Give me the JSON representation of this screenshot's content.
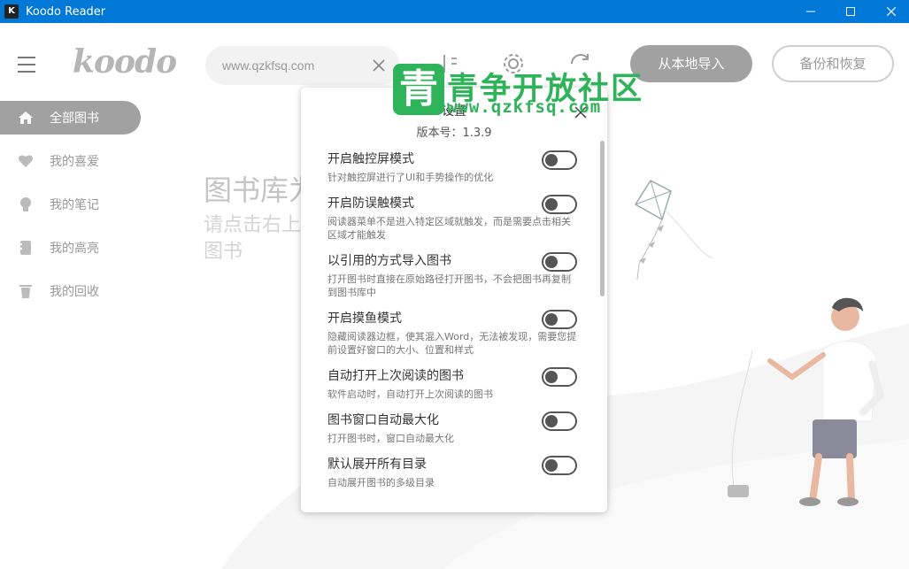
{
  "window": {
    "title": "Koodo Reader",
    "icon_letter": "K"
  },
  "header": {
    "logo": "koodo",
    "search_value": "www.qzkfsq.com",
    "import_button": "从本地导入",
    "backup_button": "备份和恢复"
  },
  "watermark": {
    "badge": "青",
    "title": "青争开放社区",
    "url": "www.qzkfsq.com"
  },
  "sidebar": {
    "items": [
      {
        "label": "全部图书",
        "icon": "home-icon",
        "active": true
      },
      {
        "label": "我的喜爱",
        "icon": "heart-icon",
        "active": false
      },
      {
        "label": "我的笔记",
        "icon": "lightbulb-icon",
        "active": false
      },
      {
        "label": "我的高亮",
        "icon": "notebook-icon",
        "active": false
      },
      {
        "label": "我的回收",
        "icon": "trash-icon",
        "active": false
      }
    ]
  },
  "empty_state": {
    "title": "图书库为空",
    "line1": "请点击右上角按钮添加",
    "line2": "图书"
  },
  "settings_dialog": {
    "title": "设置",
    "version": "版本号：1.3.9",
    "items": [
      {
        "label": "开启触控屏模式",
        "desc": "针对触控屏进行了UI和手势操作的优化",
        "enabled": false
      },
      {
        "label": "开启防误触模式",
        "desc": "阅读器菜单不是进入特定区域就触发，而是需要点击相关区域才能触发",
        "enabled": false
      },
      {
        "label": "以引用的方式导入图书",
        "desc": "打开图书时直接在原始路径打开图书，不会把图书再复制到图书库中",
        "enabled": false
      },
      {
        "label": "开启摸鱼模式",
        "desc": "隐藏阅读器边框，使其混入Word，无法被发现，需要您提前设置好窗口的大小、位置和样式",
        "enabled": false
      },
      {
        "label": "自动打开上次阅读的图书",
        "desc": "软件启动时，自动打开上次阅读的图书",
        "enabled": false
      },
      {
        "label": "图书窗口自动最大化",
        "desc": "打开图书时，窗口自动最大化",
        "enabled": false
      },
      {
        "label": "默认展开所有目录",
        "desc": "自动展开图书的多级目录",
        "enabled": false
      }
    ]
  },
  "colors": {
    "titlebar": "#0078d7",
    "sidebar_active": "#a1a1a1",
    "watermark": "#2fb35a"
  }
}
